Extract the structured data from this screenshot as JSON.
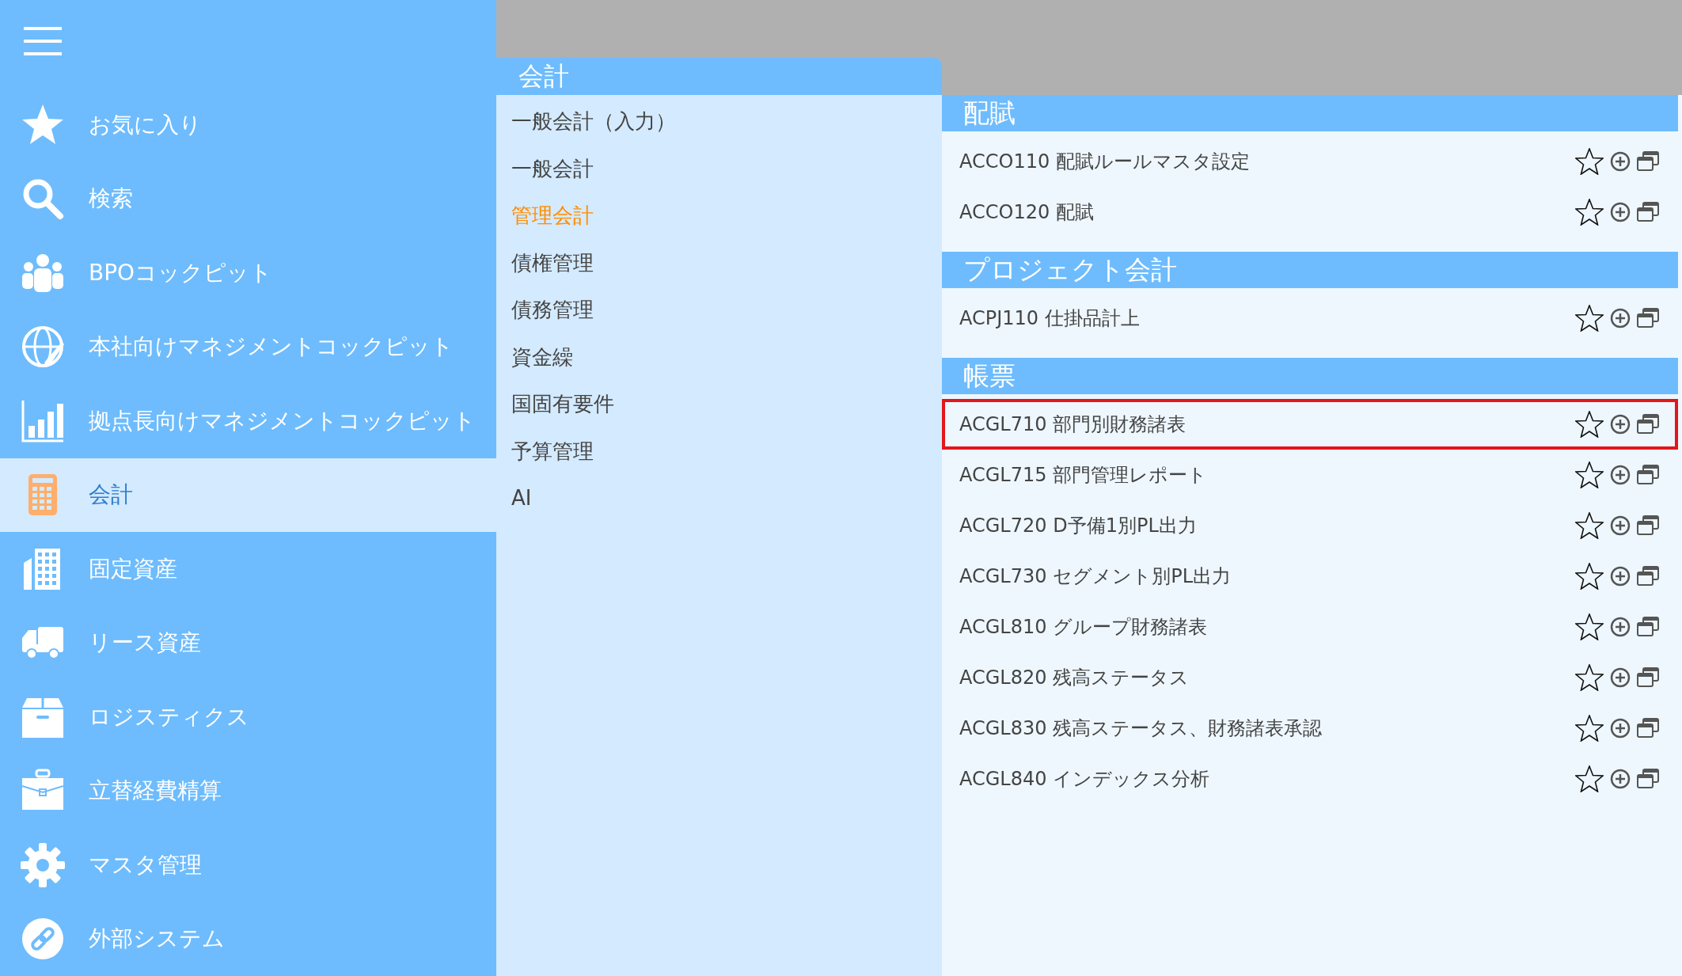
{
  "sidebar": {
    "items": [
      {
        "label": "お気に入り",
        "kind": "star",
        "selected": false
      },
      {
        "label": "検索",
        "kind": "search",
        "selected": false
      },
      {
        "label": "BPOコックピット",
        "kind": "people",
        "selected": false
      },
      {
        "label": "本社向けマネジメントコックピット",
        "kind": "globe",
        "selected": false
      },
      {
        "label": "拠点長向けマネジメントコックピット",
        "kind": "chart",
        "selected": false
      },
      {
        "label": "会計",
        "kind": "calculator",
        "selected": true
      },
      {
        "label": "固定資産",
        "kind": "building",
        "selected": false
      },
      {
        "label": "リース資産",
        "kind": "truck",
        "selected": false
      },
      {
        "label": "ロジスティクス",
        "kind": "box",
        "selected": false
      },
      {
        "label": "立替経費精算",
        "kind": "briefcase",
        "selected": false
      },
      {
        "label": "マスタ管理",
        "kind": "gear",
        "selected": false
      },
      {
        "label": "外部システム",
        "kind": "link",
        "selected": false
      }
    ]
  },
  "submenu": {
    "title": "会計",
    "items": [
      {
        "label": "一般会計（入力）",
        "selected": false
      },
      {
        "label": "一般会計",
        "selected": false
      },
      {
        "label": "管理会計",
        "selected": true
      },
      {
        "label": "債権管理",
        "selected": false
      },
      {
        "label": "債務管理",
        "selected": false
      },
      {
        "label": "資金繰",
        "selected": false
      },
      {
        "label": "国固有要件",
        "selected": false
      },
      {
        "label": "予算管理",
        "selected": false
      },
      {
        "label": "AI",
        "selected": false
      }
    ]
  },
  "sections": [
    {
      "title": "配賦",
      "items": [
        {
          "label": "ACCO110 配賦ルールマスタ設定",
          "highlighted": false
        },
        {
          "label": "ACCO120 配賦",
          "highlighted": false
        }
      ]
    },
    {
      "title": "プロジェクト会計",
      "items": [
        {
          "label": "ACPJ110 仕掛品計上",
          "highlighted": false
        }
      ]
    },
    {
      "title": "帳票",
      "items": [
        {
          "label": "ACGL710 部門別財務諸表",
          "highlighted": true
        },
        {
          "label": "ACGL715 部門管理レポート",
          "highlighted": false
        },
        {
          "label": "ACGL720 D予備1別PL出力",
          "highlighted": false
        },
        {
          "label": "ACGL730 セグメント別PL出力",
          "highlighted": false
        },
        {
          "label": "ACGL810 グループ財務諸表",
          "highlighted": false
        },
        {
          "label": "ACGL820 残高ステータス",
          "highlighted": false
        },
        {
          "label": "ACGL830 残高ステータス、財務諸表承認",
          "highlighted": false
        },
        {
          "label": "ACGL840 インデックス分析",
          "highlighted": false
        }
      ]
    }
  ]
}
